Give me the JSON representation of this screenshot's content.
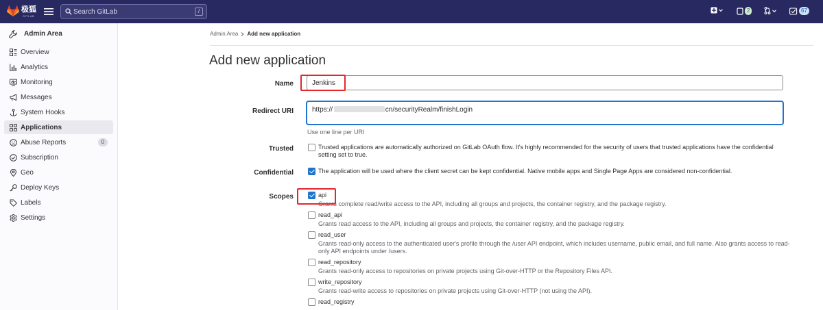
{
  "topbar": {
    "brand": "极狐",
    "brand_sub": "GITLAB",
    "search_placeholder": "Search GitLab",
    "search_shortcut": "/",
    "merge_requests_count": "2",
    "todos_count": "67"
  },
  "sidebar": {
    "title": "Admin Area",
    "items": [
      {
        "label": "Overview",
        "icon": "overview-icon"
      },
      {
        "label": "Analytics",
        "icon": "analytics-icon"
      },
      {
        "label": "Monitoring",
        "icon": "monitor-icon"
      },
      {
        "label": "Messages",
        "icon": "bullhorn-icon"
      },
      {
        "label": "System Hooks",
        "icon": "hook-icon"
      },
      {
        "label": "Applications",
        "icon": "applications-icon"
      },
      {
        "label": "Abuse Reports",
        "icon": "abuse-icon",
        "count": "0"
      },
      {
        "label": "Subscription",
        "icon": "subscription-icon"
      },
      {
        "label": "Geo",
        "icon": "geo-icon"
      },
      {
        "label": "Deploy Keys",
        "icon": "key-icon"
      },
      {
        "label": "Labels",
        "icon": "label-icon"
      },
      {
        "label": "Settings",
        "icon": "gear-icon"
      }
    ]
  },
  "breadcrumb": {
    "root": "Admin Area",
    "current": "Add new application"
  },
  "page_title": "Add new application",
  "form": {
    "name_label": "Name",
    "name_value": "Jenkins",
    "redirect_label": "Redirect URI",
    "redirect_prefix": "https://",
    "redirect_suffix": ".cn/securityRealm/finishLogin",
    "redirect_hint": "Use one line per URI",
    "trusted_label": "Trusted",
    "trusted_text": "Trusted applications are automatically authorized on GitLab OAuth flow. It's highly recommended for the security of users that trusted applications have the confidential setting set to true.",
    "confidential_label": "Confidential",
    "confidential_text": "The application will be used where the client secret can be kept confidential. Native mobile apps and Single Page Apps are considered non-confidential.",
    "scopes_label": "Scopes",
    "scopes": [
      {
        "name": "api",
        "checked": true,
        "desc": "Grants complete read/write access to the API, including all groups and projects, the container registry, and the package registry."
      },
      {
        "name": "read_api",
        "checked": false,
        "desc": "Grants read access to the API, including all groups and projects, the container registry, and the package registry."
      },
      {
        "name": "read_user",
        "checked": false,
        "desc": "Grants read-only access to the authenticated user's profile through the /user API endpoint, which includes username, public email, and full name. Also grants access to read-only API endpoints under /users."
      },
      {
        "name": "read_repository",
        "checked": false,
        "desc": "Grants read-only access to repositories on private projects using Git-over-HTTP or the Repository Files API."
      },
      {
        "name": "write_repository",
        "checked": false,
        "desc": "Grants read-write access to repositories on private projects using Git-over-HTTP (not using the API)."
      },
      {
        "name": "read_registry",
        "checked": false,
        "desc": ""
      }
    ]
  },
  "colors": {
    "topbar": "#292961",
    "accent": "#1f75cb",
    "highlight": "#e3262a"
  }
}
